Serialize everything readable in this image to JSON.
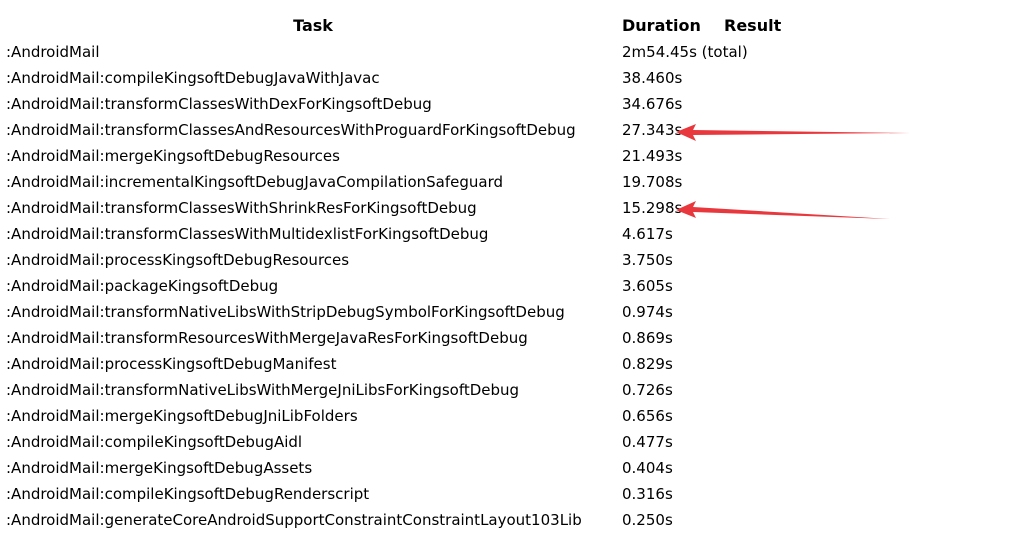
{
  "table": {
    "headers": {
      "task": "Task",
      "duration": "Duration",
      "result": "Result"
    },
    "rows": [
      {
        "task": ":AndroidMail",
        "duration": "2m54.45s (total)",
        "result": ""
      },
      {
        "task": ":AndroidMail:compileKingsoftDebugJavaWithJavac",
        "duration": "38.460s",
        "result": ""
      },
      {
        "task": ":AndroidMail:transformClassesWithDexForKingsoftDebug",
        "duration": "34.676s",
        "result": ""
      },
      {
        "task": ":AndroidMail:transformClassesAndResourcesWithProguardForKingsoftDebug",
        "duration": "27.343s",
        "result": ""
      },
      {
        "task": ":AndroidMail:mergeKingsoftDebugResources",
        "duration": "21.493s",
        "result": ""
      },
      {
        "task": ":AndroidMail:incrementalKingsoftDebugJavaCompilationSafeguard",
        "duration": "19.708s",
        "result": ""
      },
      {
        "task": ":AndroidMail:transformClassesWithShrinkResForKingsoftDebug",
        "duration": "15.298s",
        "result": ""
      },
      {
        "task": ":AndroidMail:transformClassesWithMultidexlistForKingsoftDebug",
        "duration": "4.617s",
        "result": ""
      },
      {
        "task": ":AndroidMail:processKingsoftDebugResources",
        "duration": "3.750s",
        "result": ""
      },
      {
        "task": ":AndroidMail:packageKingsoftDebug",
        "duration": "3.605s",
        "result": ""
      },
      {
        "task": ":AndroidMail:transformNativeLibsWithStripDebugSymbolForKingsoftDebug",
        "duration": "0.974s",
        "result": ""
      },
      {
        "task": ":AndroidMail:transformResourcesWithMergeJavaResForKingsoftDebug",
        "duration": "0.869s",
        "result": ""
      },
      {
        "task": ":AndroidMail:processKingsoftDebugManifest",
        "duration": "0.829s",
        "result": ""
      },
      {
        "task": ":AndroidMail:transformNativeLibsWithMergeJniLibsForKingsoftDebug",
        "duration": "0.726s",
        "result": ""
      },
      {
        "task": ":AndroidMail:mergeKingsoftDebugJniLibFolders",
        "duration": "0.656s",
        "result": ""
      },
      {
        "task": ":AndroidMail:compileKingsoftDebugAidl",
        "duration": "0.477s",
        "result": ""
      },
      {
        "task": ":AndroidMail:mergeKingsoftDebugAssets",
        "duration": "0.404s",
        "result": ""
      },
      {
        "task": ":AndroidMail:compileKingsoftDebugRenderscript",
        "duration": "0.316s",
        "result": ""
      },
      {
        "task": ":AndroidMail:generateCoreAndroidSupportConstraintConstraintLayout103Lib",
        "duration": "0.250s",
        "result": ""
      }
    ]
  },
  "annotations": {
    "arrow_color": "#e8383d",
    "highlighted_rows": [
      3,
      6
    ]
  }
}
